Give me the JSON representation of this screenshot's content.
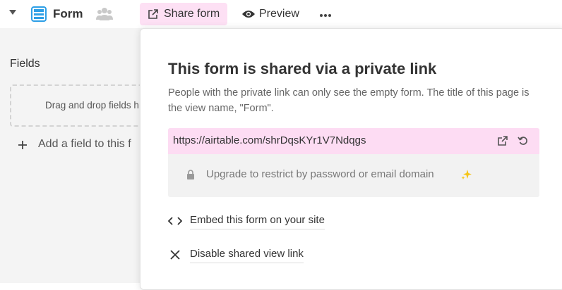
{
  "topbar": {
    "view_name": "Form",
    "share_label": "Share form",
    "preview_label": "Preview"
  },
  "left": {
    "fields_title": "Fields",
    "dropzone_text": "Drag and drop fields h",
    "add_field_label": "Add a field to this f"
  },
  "popover": {
    "title": "This form is shared via a private link",
    "description": "People with the private link can only see the empty form. The title of this page is the view name, \"Form\".",
    "link_url": "https://airtable.com/shrDqsKYr1V7Ndqgs",
    "upgrade_text": "Upgrade to restrict by password or email domain",
    "embed_label": "Embed this form on your site",
    "disable_label": "Disable shared view link"
  },
  "colors": {
    "accent_pink": "#fde0f4",
    "form_icon_blue": "#2d9fe6",
    "sparkle_yellow": "#f5c518"
  },
  "icons": [
    "caret-down-icon",
    "form-view-icon",
    "people-icon",
    "share-icon",
    "eye-icon",
    "more-icon",
    "plus-icon",
    "open-link-icon",
    "refresh-icon",
    "lock-icon",
    "sparkle-icon",
    "code-icon",
    "close-icon"
  ]
}
